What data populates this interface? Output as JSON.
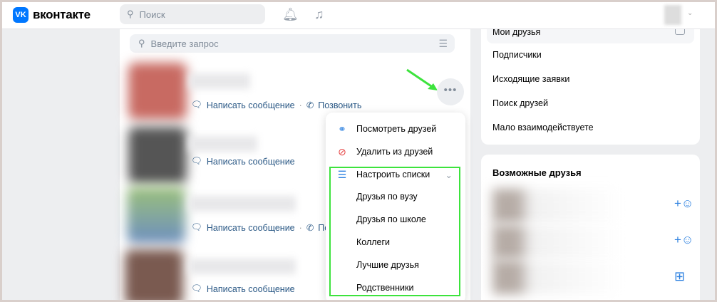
{
  "header": {
    "logo": "VK",
    "brand": "вконтакте",
    "search_placeholder": "Поиск"
  },
  "main": {
    "search_placeholder": "Введите запрос",
    "friends": [
      {
        "write": "Написать сообщение",
        "call": "Позвонить"
      },
      {
        "write": "Написать сообщение"
      },
      {
        "write": "Написать сообщение",
        "call": "Позвонить"
      },
      {
        "write": "Написать сообщение"
      }
    ]
  },
  "menu": {
    "view_friends": "Посмотреть друзей",
    "remove": "Удалить из друзей",
    "lists": "Настроить списки",
    "list_items": [
      "Друзья по вузу",
      "Друзья по школе",
      "Коллеги",
      "Лучшие друзья",
      "Родственники"
    ]
  },
  "right": {
    "my_friends": "Мои друзья",
    "items": [
      "Подписчики",
      "Исходящие заявки",
      "Поиск друзей",
      "Мало взаимодействуете"
    ],
    "suggest_title": "Возможные друзья"
  },
  "colors": {
    "accent": "#0077ff",
    "link": "#2a5885",
    "highlight": "#3de33d"
  }
}
